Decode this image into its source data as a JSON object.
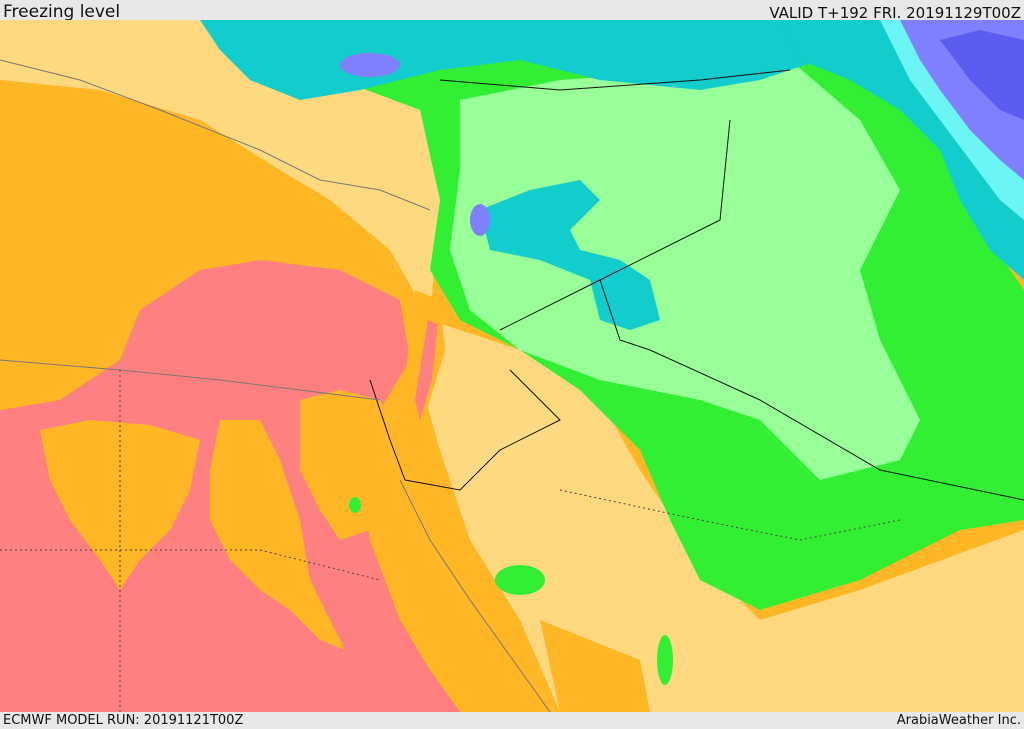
{
  "header": {
    "title": "Freezing level",
    "valid": "VALID T+192 FRI. 20191129T00Z"
  },
  "footer": {
    "model_run": "ECMWF MODEL RUN: 20191121T00Z",
    "brand": "ArabiaWeather Inc."
  },
  "colors": {
    "red": "#ff8080",
    "orange": "#ffb726",
    "tan": "#ffd980",
    "green": "#33ef33",
    "light_green": "#99ff99",
    "teal": "#13cccc",
    "cyan": "#6cf5f5",
    "blue_violet": "#8080ff",
    "violet": "#5c5cf0",
    "borders": "#111111",
    "coast": "#666666"
  }
}
